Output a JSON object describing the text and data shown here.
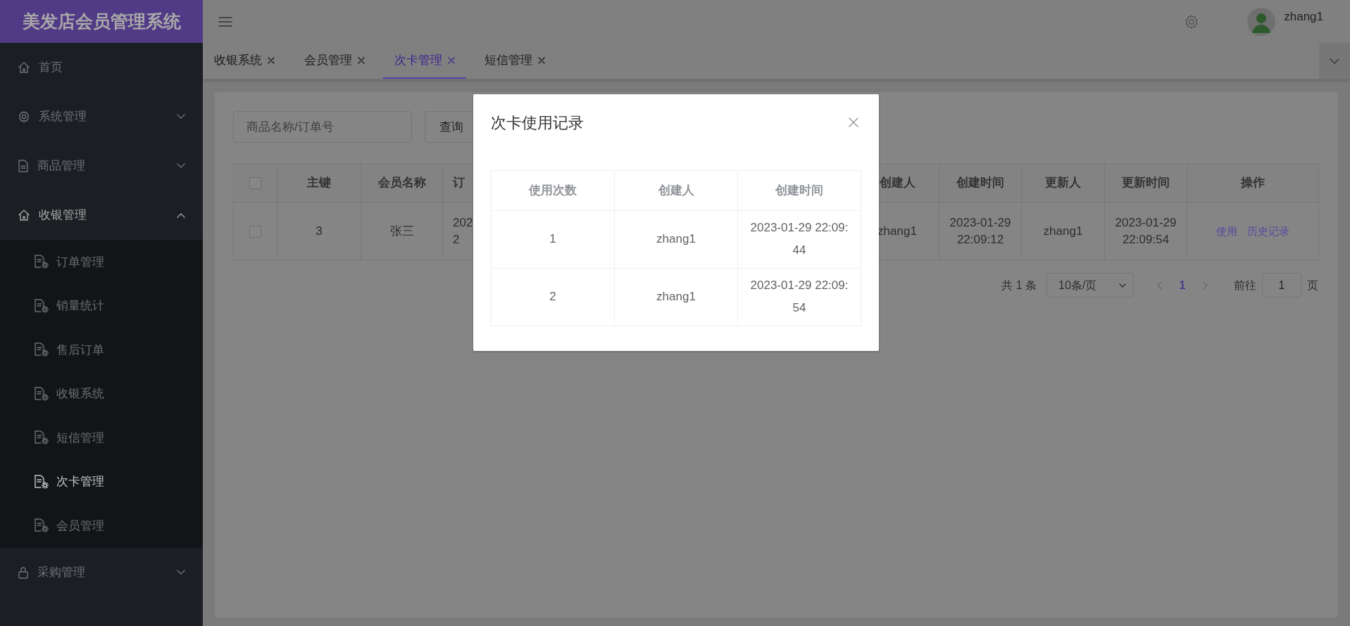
{
  "app": {
    "title": "美发店会员管理系统"
  },
  "sidebar": {
    "items": [
      {
        "label": "首页",
        "kind": "link",
        "expanded": false,
        "selected": false
      },
      {
        "label": "系统管理",
        "kind": "submenu",
        "expanded": false,
        "selected": false
      },
      {
        "label": "商品管理",
        "kind": "submenu",
        "expanded": false,
        "selected": false
      },
      {
        "label": "收银管理",
        "kind": "submenu",
        "expanded": true,
        "selected": false,
        "children": [
          {
            "label": "订单管理",
            "selected": false
          },
          {
            "label": "销量统计",
            "selected": false
          },
          {
            "label": "售后订单",
            "selected": false
          },
          {
            "label": "收银系统",
            "selected": false
          },
          {
            "label": "短信管理",
            "selected": false
          },
          {
            "label": "次卡管理",
            "selected": true
          },
          {
            "label": "会员管理",
            "selected": false
          }
        ]
      },
      {
        "label": "采购管理",
        "kind": "submenu",
        "expanded": false,
        "selected": false
      }
    ]
  },
  "header": {
    "user": {
      "name": "zhang1"
    }
  },
  "tabs": [
    {
      "label": "收银系统",
      "selected": false
    },
    {
      "label": "会员管理",
      "selected": false
    },
    {
      "label": "次卡管理",
      "selected": true
    },
    {
      "label": "短信管理",
      "selected": false
    }
  ],
  "search": {
    "placeholder": "商品名称/订单号",
    "button": "查询"
  },
  "table": {
    "all_selected": false,
    "columns": [
      "主键",
      "会员名称",
      "订",
      "创建人",
      "创建时间",
      "更新人",
      "更新时间",
      "操作"
    ],
    "rows": [
      {
        "selected": false,
        "cells": [
          "3",
          "张三",
          "202\n2",
          "zhang1",
          "2023-01-29 22:09:12",
          "zhang1",
          "2023-01-29 22:09:54"
        ],
        "actions": [
          "使用",
          "历史记录"
        ]
      }
    ]
  },
  "pagination": {
    "total": "共 1 条",
    "page_size": "10条/页",
    "pages": [
      {
        "label": "1",
        "selected": true
      }
    ],
    "goto_label": "前往",
    "goto_value": "1",
    "goto_suffix": "页"
  },
  "modal": {
    "title": "次卡使用记录",
    "columns": [
      "使用次数",
      "创建人",
      "创建时间"
    ],
    "rows": [
      [
        "1",
        "zhang1",
        "2023-01-29 22:09:44"
      ],
      [
        "2",
        "zhang1",
        "2023-01-29 22:09:54"
      ]
    ]
  }
}
